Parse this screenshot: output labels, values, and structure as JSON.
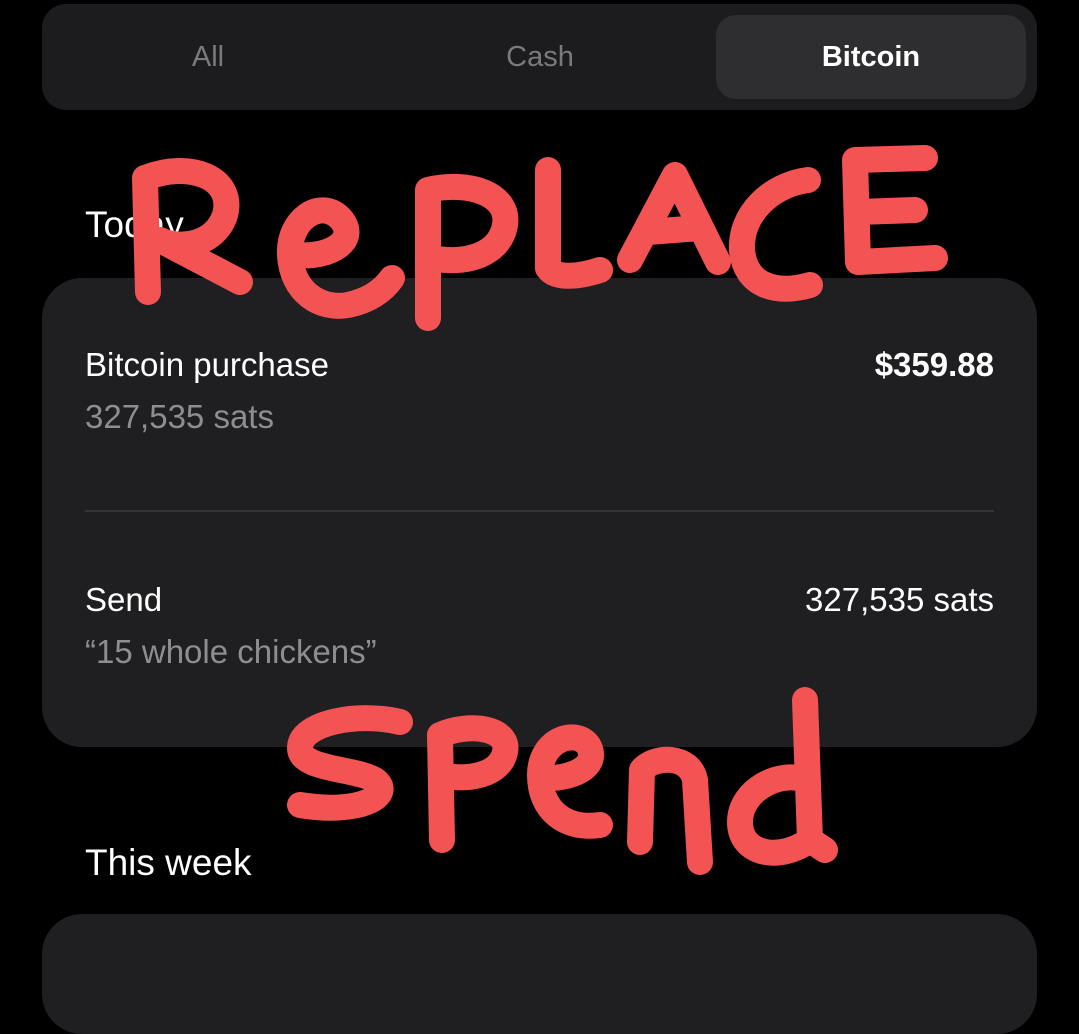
{
  "tabs": [
    {
      "label": "All",
      "active": false
    },
    {
      "label": "Cash",
      "active": false
    },
    {
      "label": "Bitcoin",
      "active": true
    }
  ],
  "sections": {
    "today": {
      "title": "Today",
      "transactions": [
        {
          "title": "Bitcoin purchase",
          "subtitle": "327,535 sats",
          "amount": "$359.88"
        },
        {
          "title": "Send",
          "subtitle": "“15 whole chickens”",
          "amount": "327,535 sats"
        }
      ]
    },
    "this_week": {
      "title": "This week"
    }
  },
  "annotations": {
    "top": "REPLACE",
    "bottom": "spend",
    "color": "#f45353"
  },
  "colors": {
    "background": "#000000",
    "card": "#1f1f21",
    "active_tab": "#2e2e30",
    "muted_text": "#8e8e92"
  }
}
